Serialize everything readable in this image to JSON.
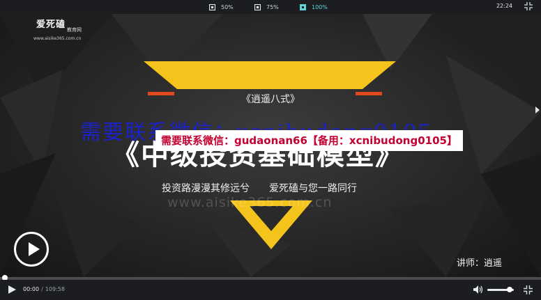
{
  "toolbar": {
    "zoom_options": [
      {
        "label": "50%",
        "active": false
      },
      {
        "label": "75%",
        "active": false
      },
      {
        "label": "100%",
        "active": true
      }
    ],
    "clock": "22:24"
  },
  "logo": {
    "title": "爱死磕",
    "subtitle": "教育网",
    "url": "www.aisike365.com.cn"
  },
  "slide": {
    "course_name": "《逍遥八式》",
    "watermark_overlay": "需要联系微信：xcnibudong0105",
    "headline": "《中级投资基础模型》",
    "red_banner": "需要联系微信：gudaonan66【备用：xcnibudong0105】",
    "slogan_left": "投资路漫漫其修远兮",
    "slogan_right": "爱死磕与您一路同行",
    "site_watermark": "www.aisike365.com.cn",
    "lecturer": "讲师：逍遥"
  },
  "player": {
    "current_time": "00:00",
    "separator": "/",
    "duration": "109:58",
    "progress_fraction": 0.0,
    "volume_fraction": 0.85,
    "accent_color": "#5fd3d8",
    "triangle_color": "#f5c41c",
    "red_bar_color": "#e04a1c"
  },
  "icons": {
    "play": "play-icon",
    "big_play": "play-circle-icon",
    "volume": "volume-icon",
    "fullscreen": "fullscreen-exit-icon"
  }
}
